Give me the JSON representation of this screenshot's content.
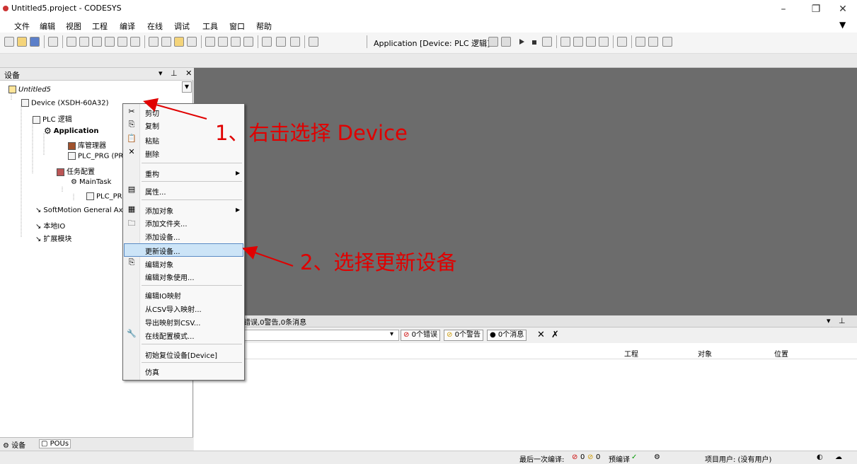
{
  "window": {
    "title": "Untitled5.project - CODESYS",
    "minimize": "–",
    "restore": "❐",
    "close": "✕"
  },
  "menu": {
    "items": [
      "文件",
      "编辑",
      "视图",
      "工程",
      "编译",
      "在线",
      "调试",
      "工具",
      "窗口",
      "帮助"
    ],
    "dropdown_glyph": "▼"
  },
  "toolbar": {
    "application_label": "Application [Device: PLC 逻辑]"
  },
  "devices_panel": {
    "title": "设备",
    "controls": "▾ ⊥ ✕",
    "tree": [
      "Untitled5",
      "Device (XSDH-60A32)",
      "PLC 逻辑",
      "Application",
      "库管理器",
      "PLC_PRG (PRG)",
      "任务配置",
      "MainTask",
      "PLC_PRG",
      "SoftMotion General Axis Pool",
      "本地IO",
      "扩展模块"
    ]
  },
  "context_menu": {
    "items": [
      "剪切",
      "复制",
      "粘贴",
      "删除",
      "重构",
      "属性...",
      "添加对象",
      "添加文件夹...",
      "添加设备...",
      "更新设备...",
      "编辑对象",
      "编辑对象使用...",
      "编辑IO映射",
      "从CSV导入映射...",
      "导出映射到CSV...",
      "在线配置模式...",
      "初始复位设备[Device]",
      "仿真"
    ],
    "highlighted": "更新设备..."
  },
  "messages": {
    "title": "错误,0警告,0条消息",
    "controls": "▾ ⊥ ✕",
    "btn_errors": "0个错误",
    "btn_warnings": "0个警告",
    "btn_messages": "0个消息",
    "columns": [
      "工程",
      "对象",
      "位置"
    ]
  },
  "bottom_tabs": [
    "设备",
    "POUs"
  ],
  "status": {
    "last_compile": "最后一次编译:",
    "errs": "0",
    "warns": "0",
    "precompile": "预编译",
    "project_user": "项目用户: (没有用户)"
  },
  "annotations": {
    "step1": "1、右击选择 Device",
    "step2": "2、选择更新设备"
  },
  "colors": {
    "annotation": "#e00000",
    "highlight": "#cce4f7",
    "editor_bg": "#6c6c6c"
  }
}
